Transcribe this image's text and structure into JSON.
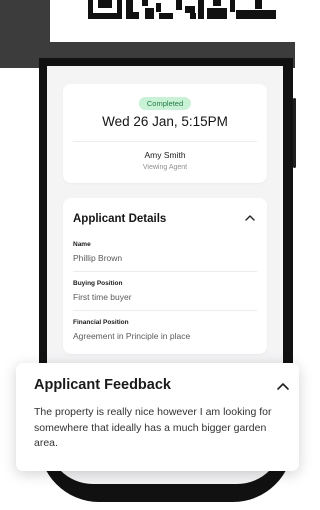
{
  "appointment": {
    "status": "Completed",
    "date_time": "Wed 26 Jan, 5:15PM",
    "agent_name": "Amy Smith",
    "agent_role": "Viewing Agent"
  },
  "applicant_details": {
    "title": "Applicant Details",
    "icon": "chevron-up-icon",
    "fields": [
      {
        "label": "Name",
        "value": "Phillip Brown"
      },
      {
        "label": "Buying Position",
        "value": "First time buyer"
      },
      {
        "label": "Financial Position",
        "value": "Agreement in Principle in place"
      }
    ]
  },
  "feedback": {
    "title": "Applicant Feedback",
    "icon": "chevron-up-icon",
    "text": "The property is really nice however I am looking for somewhere that ideally has a much bigger garden area."
  },
  "colors": {
    "badge_bg": "#c9f1d6",
    "badge_text": "#1f7a43",
    "screen_bg": "#f4f4f5",
    "phone_frame": "#111111"
  }
}
